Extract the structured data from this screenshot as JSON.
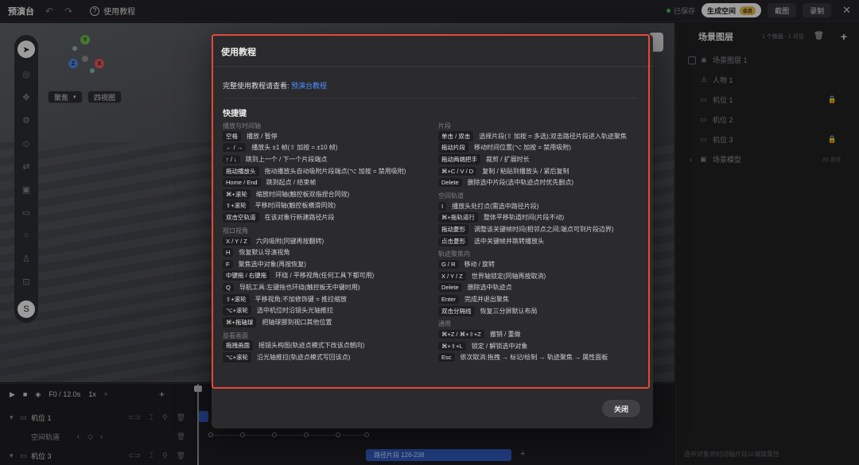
{
  "topbar": {
    "title": "预演台",
    "help_label": "使用教程",
    "saved": "已保存",
    "generate_label": "生成空间",
    "vip_badge": "会员",
    "screenshot_label": "截图",
    "record_label": "录制"
  },
  "viewport": {
    "focus_label": "聚焦",
    "four_view_label": "四视图",
    "axis_x": "X",
    "axis_y": "Y",
    "axis_z": "Z"
  },
  "right_panel": {
    "title": "场景图层",
    "meta": "1 个图层 · 1 可见",
    "layers": [
      {
        "label": "场景图层 1",
        "icon": "eye-icon"
      },
      {
        "label": "人物 1",
        "icon": "person-icon"
      },
      {
        "label": "机位 1",
        "icon": "camera-icon",
        "locked": true
      },
      {
        "label": "机位 2",
        "icon": "camera-icon"
      },
      {
        "label": "机位 3",
        "icon": "camera-icon",
        "locked": true
      },
      {
        "label": "场景模型",
        "icon": "cube-icon",
        "count": "86 部件"
      }
    ],
    "footer": "选中对象将时间轴片段以编辑属性"
  },
  "timeline": {
    "frame": "F0 / 12.0s",
    "speed": "1x",
    "rows": [
      {
        "label": "机位 1"
      },
      {
        "label": "空间轨道"
      },
      {
        "label": "机位 3"
      }
    ],
    "clip_label": "路径片段 126-238"
  },
  "modal": {
    "title": "使用教程",
    "intro_text": "完整使用教程请查看:",
    "intro_link": "预演台教程",
    "shortcuts_title": "快捷键",
    "left_sections": [
      {
        "title": "播放与时间轴",
        "rows": [
          {
            "key": "空格",
            "desc": "播放 / 暂停"
          },
          {
            "key": "← / →",
            "desc": "播放头 ±1 帧(⇧ 加按 = ±10 帧)"
          },
          {
            "key": "↑ / ↓",
            "desc": "跳到上一个 / 下一个片段端点"
          },
          {
            "key": "拖动播放头",
            "desc": "拖动播放头自动吸附片段端点(⌥ 加按 = 禁用吸附)"
          },
          {
            "key": "Home / End",
            "desc": "跳到起点 / 结束帧"
          },
          {
            "key": "⌘+滚轮",
            "desc": "缩放时间轴(触控板双指捏合同效)"
          },
          {
            "key": "⇧+滚轮",
            "desc": "平移时间轴(触控板横滑同效)"
          },
          {
            "key": "双击空轨道",
            "desc": "在该对象行新建路径片段"
          }
        ]
      },
      {
        "title": "视口视角",
        "rows": [
          {
            "key": "X / Y / Z",
            "desc": "六向吸附(同键再按翻转)"
          },
          {
            "key": "H",
            "desc": "恢复默认导演视角"
          },
          {
            "key": "F",
            "desc": "聚焦选中对象(再按恢复)"
          },
          {
            "key": "中键拖 / 右键拖",
            "desc": "环绕 / 平移视角(任何工具下都可用)"
          },
          {
            "key": "Q",
            "desc": "导航工具:左键拖也环绕(触控板无中键时用)"
          },
          {
            "key": "⇧+滚轮",
            "desc": "平移视角;不加修饰键 = 推拉缩放"
          },
          {
            "key": "⌥+滚轮",
            "desc": "选中机位时沿镜头光轴推拉"
          },
          {
            "key": "⌘+拖轴球",
            "desc": "把轴球挪到视口其他位置"
          }
        ]
      },
      {
        "title": "监看画面",
        "rows": [
          {
            "key": "拖拽画面",
            "desc": "摇镜头构图(轨迹点模式下改该点朝向)"
          },
          {
            "key": "⌥+滚轮",
            "desc": "沿光轴推拉(轨迹点模式写回该点)"
          }
        ]
      }
    ],
    "right_sections": [
      {
        "title": "片段",
        "rows": [
          {
            "key": "单击 / 双击",
            "desc": "选择片段(⇧ 加按 = 多选);双击路径片段进入轨迹聚焦"
          },
          {
            "key": "拖动片段",
            "desc": "移动时间位置(⌥ 加按 = 禁用吸附)"
          },
          {
            "key": "拖动两端把手",
            "desc": "裁剪 / 扩展时长"
          },
          {
            "key": "⌘+C / V / D",
            "desc": "复制 / 粘贴到播放头 / 紧后复制"
          },
          {
            "key": "Delete",
            "desc": "删除选中片段(选中轨迹点时优先删点)"
          }
        ]
      },
      {
        "title": "空间轨道",
        "rows": [
          {
            "key": "I",
            "desc": "播放头处打点(需选中路径片段)"
          },
          {
            "key": "⌘+拖轨道行",
            "desc": "整体平移轨道时间(片段不动)"
          },
          {
            "key": "拖动菱形",
            "desc": "调整该关键帧时间(相邻点之间;端点可到片段边界)"
          },
          {
            "key": "点击菱形",
            "desc": "选中关键帧并跳转播放头"
          }
        ]
      },
      {
        "title": "轨迹聚焦内",
        "rows": [
          {
            "key": "G / R",
            "desc": "移动 / 旋转"
          },
          {
            "key": "X / Y / Z",
            "desc": "世界轴锁定(同轴再按取消)"
          },
          {
            "key": "Delete",
            "desc": "删除选中轨迹点"
          },
          {
            "key": "Enter",
            "desc": "完成并退出聚焦"
          },
          {
            "key": "双击分隔线",
            "desc": "恢复三分屏默认布局"
          }
        ]
      },
      {
        "title": "通用",
        "rows": [
          {
            "key": "⌘+Z / ⌘+⇧+Z",
            "desc": "撤销 / 重做"
          },
          {
            "key": "⌘+⇧+L",
            "desc": "锁定 / 解锁选中对象"
          },
          {
            "key": "Esc",
            "desc": "依次取消:拖拽 → 标记/绘制 → 轨迹聚焦 → 属性面板"
          }
        ]
      }
    ],
    "close_label": "关闭"
  }
}
